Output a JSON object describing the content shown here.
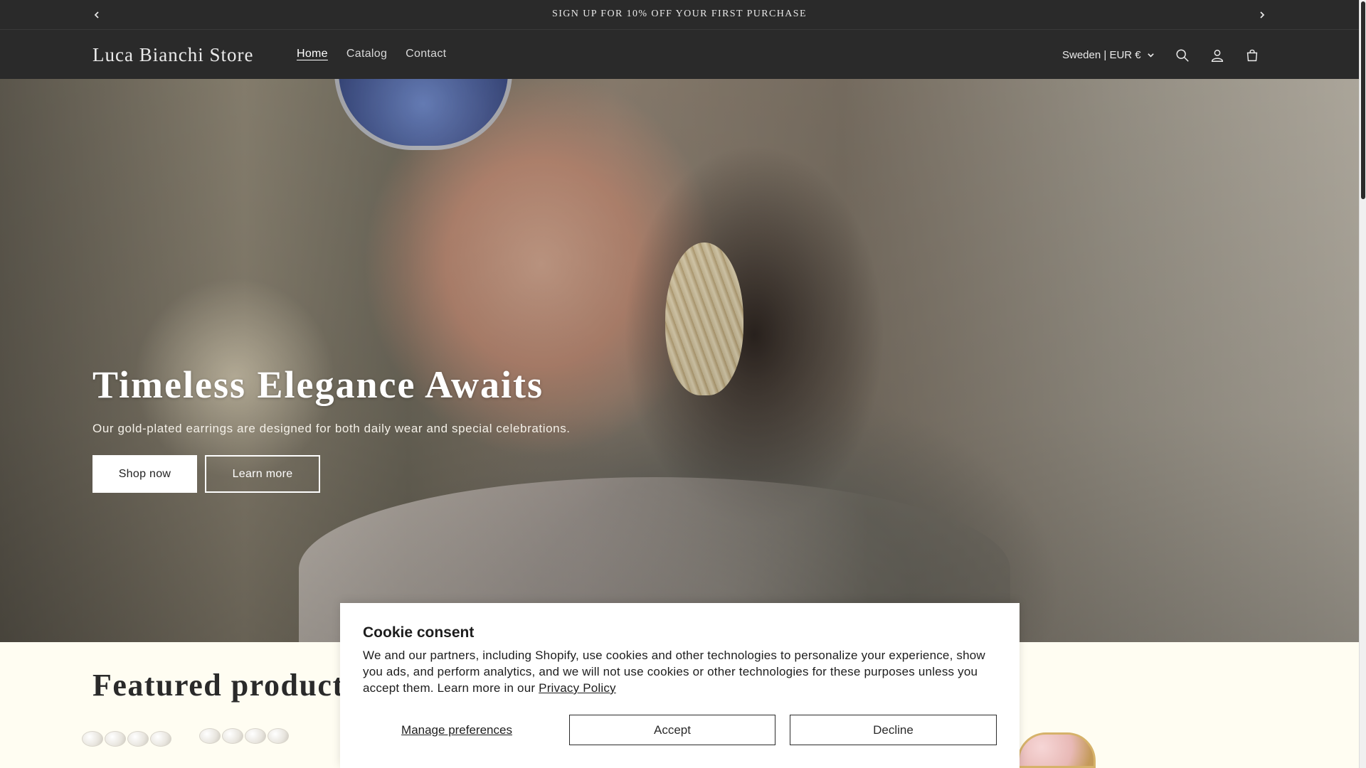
{
  "announcement": {
    "message": "SIGN UP FOR 10% OFF YOUR FIRST PURCHASE",
    "prev_icon": "chevron-left-icon",
    "next_icon": "chevron-right-icon"
  },
  "header": {
    "logo": "Luca Bianchi Store",
    "nav": [
      {
        "label": "Home",
        "active": true
      },
      {
        "label": "Catalog",
        "active": false
      },
      {
        "label": "Contact",
        "active": false
      }
    ],
    "locale": "Sweden | EUR €",
    "icons": [
      "search-icon",
      "account-icon",
      "cart-icon"
    ]
  },
  "hero": {
    "title": "Timeless Elegance Awaits",
    "subtitle": "Our gold-plated earrings are designed for both daily wear and special celebrations.",
    "primary_button": "Shop now",
    "secondary_button": "Learn more"
  },
  "featured": {
    "title": "Featured products"
  },
  "cookie": {
    "title": "Cookie consent",
    "body": "We and our partners, including Shopify, use cookies and other technologies to personalize your experience, show you ads, and perform analytics, and we will not use cookies or other technologies for these purposes unless you accept them. Learn more in our ",
    "link": "Privacy Policy",
    "manage": "Manage preferences",
    "accept": "Accept",
    "decline": "Decline"
  },
  "colors": {
    "header_bg": "#2a2a2a",
    "page_bg": "#fffdf2",
    "button_primary_bg": "#ffffff"
  }
}
